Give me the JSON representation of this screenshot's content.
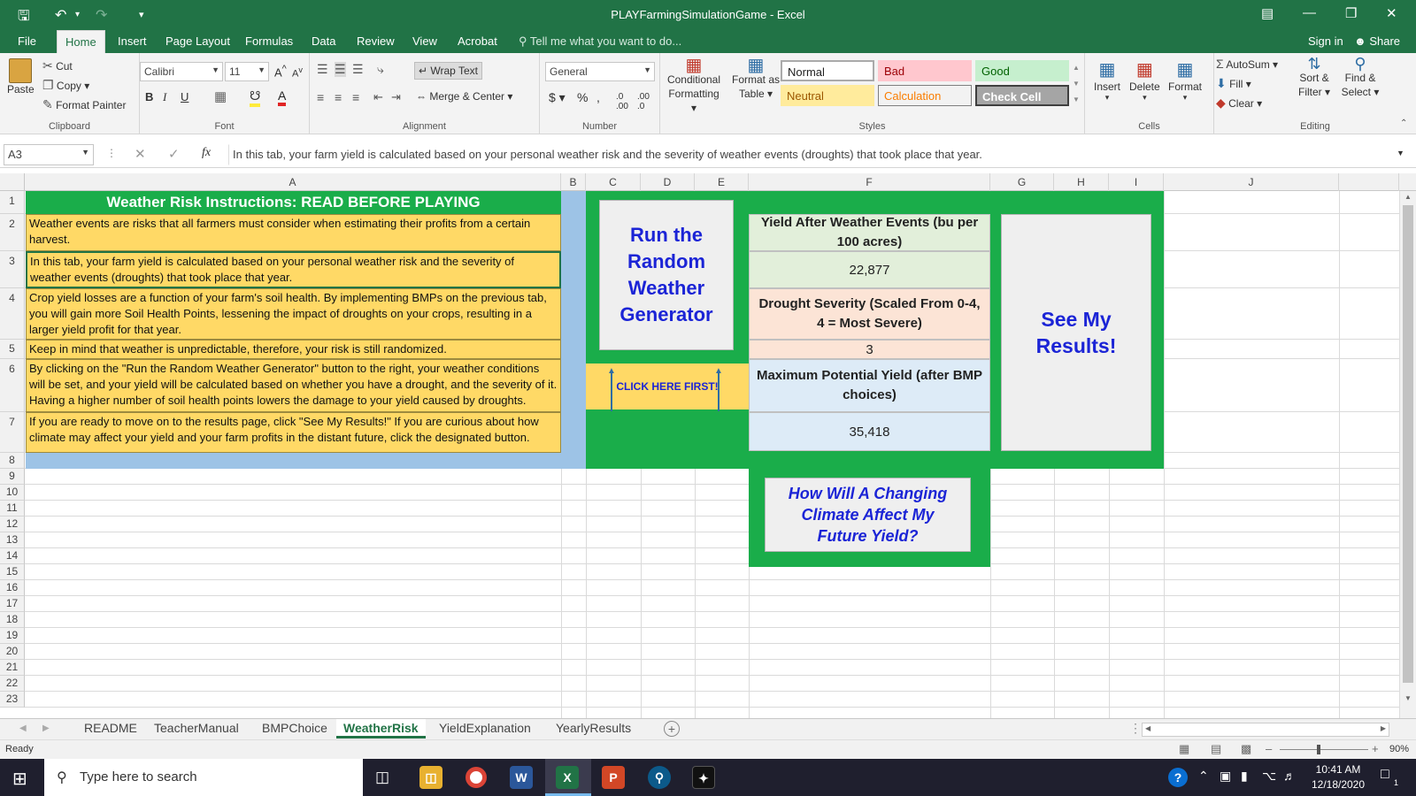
{
  "window": {
    "title": "PLAYFarmingSimulationGame - Excel",
    "restore_icon": "ribbon-display-options-icon"
  },
  "ribbon_tabs": [
    "File",
    "Home",
    "Insert",
    "Page Layout",
    "Formulas",
    "Data",
    "Review",
    "View",
    "Acrobat"
  ],
  "active_tab": "Home",
  "tell_me": "Tell me what you want to do...",
  "sign_in": "Sign in",
  "share": "Share",
  "clipboard": {
    "paste": "Paste",
    "cut": "Cut",
    "copy": "Copy",
    "format_painter": "Format Painter",
    "label": "Clipboard"
  },
  "font": {
    "name": "Calibri",
    "size": "11",
    "label": "Font"
  },
  "alignment": {
    "wrap": "Wrap Text",
    "merge": "Merge & Center",
    "label": "Alignment"
  },
  "number": {
    "format": "General",
    "label": "Number"
  },
  "styles": {
    "conditional": "Conditional Formatting",
    "format_table": "Format as Table",
    "normal": "Normal",
    "bad": "Bad",
    "good": "Good",
    "neutral": "Neutral",
    "calculation": "Calculation",
    "check_cell": "Check Cell",
    "label": "Styles"
  },
  "cells": {
    "insert": "Insert",
    "delete": "Delete",
    "format": "Format",
    "label": "Cells"
  },
  "editing": {
    "autosum": "AutoSum",
    "fill": "Fill",
    "clear": "Clear",
    "sort": "Sort & Filter",
    "find": "Find & Select",
    "label": "Editing"
  },
  "formula_bar": {
    "name_box": "A3",
    "fx": "fx",
    "content": "In this tab, your farm yield is calculated based on your personal weather risk and the severity of weather events (droughts) that took place that year."
  },
  "columns": [
    "A",
    "B",
    "C",
    "D",
    "E",
    "F",
    "G",
    "H",
    "I",
    "J"
  ],
  "rows": [
    "1",
    "2",
    "3",
    "4",
    "5",
    "6",
    "7",
    "8",
    "9",
    "10",
    "11",
    "12",
    "13",
    "14",
    "15",
    "16",
    "17",
    "18",
    "19",
    "20",
    "21",
    "22",
    "23"
  ],
  "sheet": {
    "header": "Weather Risk Instructions: READ BEFORE PLAYING",
    "instructions": [
      "Weather events are risks that all farmers must consider when estimating their profits from a certain harvest.",
      "In this tab, your farm yield is calculated based on your personal weather risk and the severity of weather events (droughts) that took place that year.",
      "Crop yield losses are a function of your farm's soil health. By implementing BMPs on the previous tab, you will gain more Soil Health Points, lessening the impact of droughts on your crops, resulting in a larger yield profit for that year.",
      "Keep in mind that weather is unpredictable, therefore, your risk is still randomized.",
      "By clicking on the \"Run the Random Weather Generator\" button to the right, your weather conditions will be set, and your yield will be calculated based on whether you have a drought, and the severity of it. Having a higher number of soil health points lowers the damage to your yield caused by droughts.",
      "If you are ready to move on to the results page, click \"See My Results!\" If you are curious about how climate may affect your yield and your farm profits in the distant future, click the designated button."
    ],
    "run_button": "Run the Random Weather Generator",
    "click_here": "CLICK HERE FIRST!",
    "yield_label": "Yield After Weather Events (bu per 100 acres)",
    "yield_value": "22,877",
    "drought_label": "Drought Severity (Scaled From 0-4, 4 = Most Severe)",
    "drought_value": "3",
    "max_label": "Maximum Potential Yield (after BMP choices)",
    "max_value": "35,418",
    "results_button": "See My Results!",
    "climate_button": "How Will A Changing Climate Affect My Future Yield?"
  },
  "sheet_tabs": [
    "README",
    "TeacherManual",
    "BMPChoice",
    "WeatherRisk",
    "YieldExplanation",
    "YearlyResults"
  ],
  "active_sheet": "WeatherRisk",
  "status": {
    "ready": "Ready",
    "zoom": "90%"
  },
  "taskbar": {
    "search": "Type here to search",
    "time": "10:41 AM",
    "date": "12/18/2020",
    "notifications": "1"
  },
  "colors": {
    "excel_green": "#217346",
    "sheet_green": "#1aad4a",
    "instr_yellow": "#ffd966",
    "header_green": "#1aad4a",
    "light_blue": "#9dc3e6",
    "peach": "#fce4d6",
    "pale_green": "#e2efda",
    "pale_blue": "#ddebf7",
    "button_text": "#1b24d6"
  }
}
